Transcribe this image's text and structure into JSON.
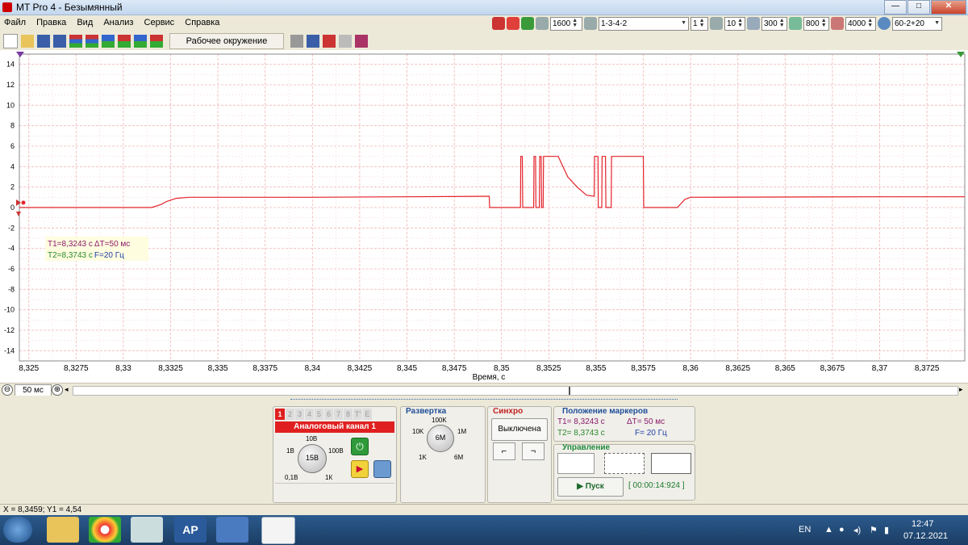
{
  "window": {
    "title": "MT Pro 4 - Безымянный",
    "min": "—",
    "max": "□",
    "close": "✕"
  },
  "menu": [
    "Файл",
    "Правка",
    "Вид",
    "Анализ",
    "Сервис",
    "Справка"
  ],
  "toolbar_right": {
    "rpm": "1600",
    "firing_order": "1-3-4-2",
    "cyl": "1",
    "val10": "10",
    "val300": "300",
    "val800": "800",
    "val4000": "4000",
    "teeth": "60-2+20"
  },
  "workspace_button": "Рабочее окружение",
  "chart_data": {
    "type": "line",
    "xlabel": "Время, с",
    "ylabel": "",
    "x_ticks": [
      "8,325",
      "8,3275",
      "8,33",
      "8,3325",
      "8,335",
      "8,3375",
      "8,34",
      "8,3425",
      "8,345",
      "8,3475",
      "8,35",
      "8,3525",
      "8,355",
      "8,3575",
      "8,36",
      "8,3625",
      "8,365",
      "8,3675",
      "8,37",
      "8,3725"
    ],
    "x_range": [
      8.3245,
      8.3745
    ],
    "y_ticks": [
      "14",
      "12",
      "10",
      "8",
      "6",
      "4",
      "2",
      "0",
      "-2",
      "-4",
      "-6",
      "-8",
      "-10",
      "-12",
      "-14"
    ],
    "y_range": [
      -15,
      15
    ],
    "grid": true,
    "series": [
      {
        "color": "#e4232a",
        "x": [
          8.3245,
          8.3315,
          8.332,
          8.3323,
          8.3328,
          8.3335,
          8.34,
          8.345,
          8.349,
          8.34935,
          8.34937,
          8.351,
          8.35102,
          8.35104,
          8.3511,
          8.35112,
          8.35114,
          8.3517,
          8.35172,
          8.35174,
          8.3518,
          8.35182,
          8.35184,
          8.352,
          8.35202,
          8.35204,
          8.3521,
          8.35212,
          8.35214,
          8.3522,
          8.35222,
          8.35224,
          8.353,
          8.3535,
          8.354,
          8.3545,
          8.3549,
          8.35492,
          8.35494,
          8.3551,
          8.35512,
          8.35514,
          8.3553,
          8.35532,
          8.35534,
          8.3555,
          8.35552,
          8.35554,
          8.3558,
          8.35582,
          8.35584,
          8.3575,
          8.35752,
          8.35754,
          8.3593,
          8.3597,
          8.36,
          8.37,
          8.3745
        ],
        "y": [
          0,
          0,
          0.3,
          0.6,
          0.9,
          1.0,
          1.0,
          1.05,
          1.1,
          1.1,
          0,
          0,
          5,
          5,
          5,
          0,
          0,
          0,
          5,
          5,
          5,
          0,
          0,
          0,
          5,
          5,
          5,
          0,
          0,
          0,
          5,
          5,
          5,
          3,
          2,
          1.2,
          1.1,
          5,
          5,
          5,
          0,
          0,
          0,
          5,
          5,
          5,
          0,
          0,
          0,
          5,
          5,
          5,
          0,
          0,
          0,
          0.8,
          1.0,
          1.05,
          1.05
        ]
      }
    ],
    "markers": {
      "t1": "T1=8,3243 с",
      "dt": "ΔT=50 мс",
      "t2": "T2=8,3743 с",
      "f": "F=20 Гц"
    }
  },
  "scroll": {
    "zoom_minus": "⊖",
    "zoom_value": "50 мс",
    "zoom_plus": "⊕"
  },
  "channel_panel": {
    "tabs": [
      "1",
      "2",
      "3",
      "4",
      "5",
      "6",
      "7",
      "8",
      "T'",
      "E"
    ],
    "header": "Аналоговый канал 1",
    "knob_center": "15В",
    "labels": {
      "top": "10В",
      "left": "1В",
      "right": "100В",
      "bl": "0,1В",
      "br": "1К"
    }
  },
  "sweep_panel": {
    "title": "Развертка",
    "knob_center": "6М",
    "labels": {
      "top": "100K",
      "left": "10K",
      "right": "1M",
      "bl": "1K",
      "br": "6M"
    }
  },
  "sync_panel": {
    "title": "Синхро",
    "button": "Выключена"
  },
  "markers_panel": {
    "title": "Положение маркеров",
    "t1": "T1= 8,3243 с",
    "dt": "ΔT= 50 мс",
    "t2": "T2= 8,3743 с",
    "f": "F= 20 Гц"
  },
  "control_panel": {
    "title": "Управление",
    "start": "Пуск",
    "timer": "[ 00:00:14:924 ]"
  },
  "statusbar": "X = 8,3459; Y1 = 4,54",
  "tray": {
    "lang": "EN",
    "time": "12:47",
    "date": "07.12.2021"
  },
  "colors": {
    "trace": "#e4232a",
    "grid": "#f3b5b5",
    "accent": "#e02020",
    "panel_title": "#1f4e96"
  }
}
